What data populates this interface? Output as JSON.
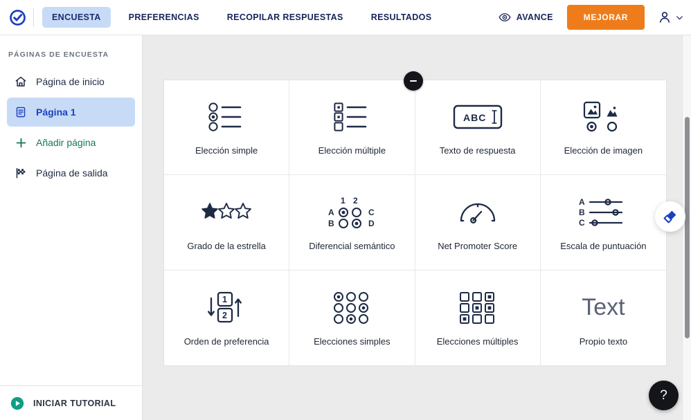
{
  "header": {
    "logo_icon": "check-circle-logo",
    "tabs": [
      {
        "label": "ENCUESTA",
        "active": true
      },
      {
        "label": "PREFERENCIAS",
        "active": false
      },
      {
        "label": "RECOPILAR RESPUESTAS",
        "active": false
      },
      {
        "label": "RESULTADOS",
        "active": false
      }
    ],
    "preview": {
      "label": "AVANCE",
      "icon": "eye-icon"
    },
    "upgrade_button": {
      "label": "MEJORAR",
      "color": "#ef7c1b"
    },
    "account": {
      "icon": "user-icon",
      "chevron": "chevron-down-icon"
    }
  },
  "sidebar": {
    "title": "PÁGINAS DE ENCUESTA",
    "items": [
      {
        "label": "Página de inicio",
        "icon": "home-icon",
        "active": false
      },
      {
        "label": "Página 1",
        "icon": "page-icon",
        "active": true,
        "menu": "•••"
      },
      {
        "label": "Añadir página",
        "icon": "plus-icon",
        "active": false
      },
      {
        "label": "Página de salida",
        "icon": "flag-icon",
        "active": false
      }
    ],
    "footer": {
      "label": "INICIAR TUTORIAL",
      "icon": "play-circle-icon"
    }
  },
  "canvas": {
    "collapse_button": {
      "icon": "minus-icon"
    },
    "theme_button": {
      "icon": "paintbrush-icon"
    },
    "help_button": {
      "label": "?"
    },
    "question_types": [
      {
        "label": "Elección simple",
        "icon": "radio-list-icon"
      },
      {
        "label": "Elección múltiple",
        "icon": "checkbox-list-icon"
      },
      {
        "label": "Texto de respuesta",
        "icon": "text-box-icon",
        "glyph": "ABC"
      },
      {
        "label": "Elección de imagen",
        "icon": "image-choice-icon"
      },
      {
        "label": "Grado de la estrella",
        "icon": "star-rating-icon"
      },
      {
        "label": "Diferencial semántico",
        "icon": "semantic-differential-icon",
        "labels": [
          "1",
          "2",
          "A",
          "B",
          "C",
          "D"
        ]
      },
      {
        "label": "Net Promoter Score",
        "icon": "gauge-icon"
      },
      {
        "label": "Escala de puntuación",
        "icon": "slider-scale-icon",
        "labels": [
          "A",
          "B",
          "C"
        ]
      },
      {
        "label": "Orden de preferencia",
        "icon": "ranking-icon",
        "labels": [
          "1",
          "2"
        ]
      },
      {
        "label": "Elecciones simples",
        "icon": "radio-grid-icon"
      },
      {
        "label": "Elecciones múltiples",
        "icon": "checkbox-grid-icon"
      },
      {
        "label": "Propio texto",
        "icon": "custom-text-icon",
        "glyph": "Text"
      }
    ]
  },
  "colors": {
    "accent_blue": "#1b3fbe",
    "active_tab_bg": "#c7dbf7",
    "orange": "#ef7c1b",
    "canvas_bg": "#ebebeb",
    "green": "#127a4e",
    "teal": "#0e9e83"
  }
}
